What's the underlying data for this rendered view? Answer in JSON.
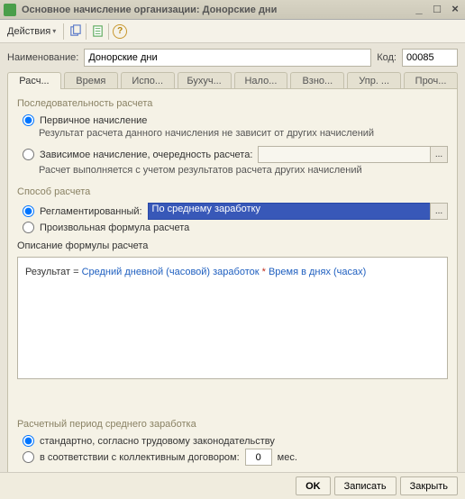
{
  "window": {
    "title": "Основное начисление организации: Донорские дни",
    "min": "_",
    "max": "□",
    "close": "×"
  },
  "toolbar": {
    "actions": "Действия"
  },
  "fields": {
    "name_label": "Наименование:",
    "name_value": "Донорские дни",
    "code_label": "Код:",
    "code_value": "00085"
  },
  "tabs": [
    "Расч...",
    "Время",
    "Испо...",
    "Бухуч...",
    "Нало...",
    "Взно...",
    "Упр. ...",
    "Проч..."
  ],
  "seq": {
    "title": "Последовательность расчета",
    "opt_primary": "Первичное начисление",
    "hint_primary": "Результат расчета данного начисления не зависит от других начислений",
    "opt_dependent": "Зависимое начисление, очередность расчета:",
    "hint_dependent": "Расчет выполняется с учетом результатов расчета других начислений"
  },
  "method": {
    "title": "Способ расчета",
    "opt_reg": "Регламентированный:",
    "reg_value": "По среднему заработку",
    "opt_custom": "Произвольная формула расчета"
  },
  "formula": {
    "title": "Описание формулы расчета",
    "label": "Результат = ",
    "part1": "Средний дневной (часовой) заработок",
    "op": " * ",
    "part2": "Время в днях (часах)"
  },
  "period": {
    "title": "Расчетный период среднего заработка",
    "opt_std": "стандартно, согласно трудовому законодательству",
    "opt_coll": "в соответствии с коллективным договором:",
    "months_value": "0",
    "months_suffix": "мес."
  },
  "footer": {
    "ok": "OK",
    "save": "Записать",
    "close": "Закрыть"
  }
}
